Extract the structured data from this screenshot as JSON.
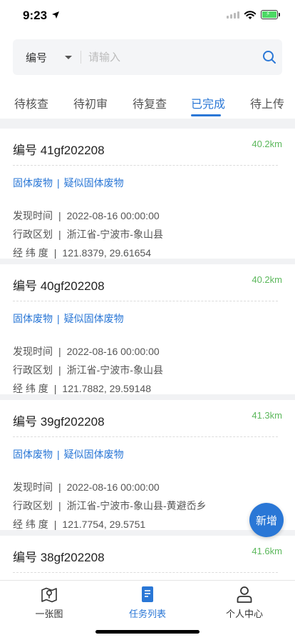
{
  "status": {
    "time": "9:23"
  },
  "search": {
    "select_label": "编号",
    "placeholder": "请输入",
    "value": ""
  },
  "tabs": [
    {
      "label": "待核查",
      "active": false
    },
    {
      "label": "待初审",
      "active": false
    },
    {
      "label": "待复查",
      "active": false
    },
    {
      "label": "已完成",
      "active": true
    },
    {
      "label": "待上传",
      "active": false
    }
  ],
  "row_labels": {
    "time": "发现时间",
    "region": "行政区划",
    "coord": "经 纬 度",
    "sep": "|"
  },
  "cards": [
    {
      "code": "编号 41gf202208",
      "distance": "40.2km",
      "tag1": "固体废物",
      "tag2": "疑似固体废物",
      "time": "2022-08-16 00:00:00",
      "region": "浙江省-宁波市-象山县",
      "coord": "121.8379, 29.61654"
    },
    {
      "code": "编号 40gf202208",
      "distance": "40.2km",
      "tag1": "固体废物",
      "tag2": "疑似固体废物",
      "time": "2022-08-16 00:00:00",
      "region": "浙江省-宁波市-象山县",
      "coord": "121.7882, 29.59148"
    },
    {
      "code": "编号 39gf202208",
      "distance": "41.3km",
      "tag1": "固体废物",
      "tag2": "疑似固体废物",
      "time": "2022-08-16 00:00:00",
      "region": "浙江省-宁波市-象山县-黄避岙乡",
      "coord": "121.7754, 29.5751"
    },
    {
      "code": "编号 38gf202208",
      "distance": "41.6km"
    }
  ],
  "fab": {
    "label": "新增"
  },
  "bottom_nav": [
    {
      "label": "一张图",
      "icon": "map-icon",
      "active": false
    },
    {
      "label": "任务列表",
      "icon": "document-icon",
      "active": true
    },
    {
      "label": "个人中心",
      "icon": "user-icon",
      "active": false
    }
  ],
  "colors": {
    "accent": "#2a77d6",
    "distance": "#5cb85c"
  }
}
